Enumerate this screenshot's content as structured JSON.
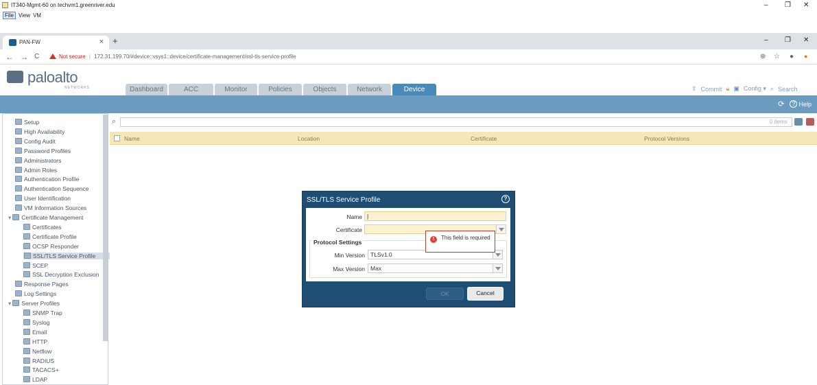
{
  "vm_window": {
    "title": "IT340-Mgmt-60 on techvm1.greenriver.edu",
    "menu": [
      "File",
      "View",
      "VM"
    ],
    "controls": [
      "–",
      "❐",
      "✕"
    ]
  },
  "browser": {
    "tab_title": "PAN-FW",
    "tab_close": "×",
    "new_tab": "+",
    "not_secure": "Not secure",
    "url": "172.31.199.70/#device::vsys1::device/certificate-management/ssl-tls-service-profile",
    "nav": [
      "←",
      "→",
      "C"
    ],
    "controls": [
      "–",
      "❐",
      "✕"
    ]
  },
  "app": {
    "logo_word": "paloalto",
    "logo_sub": "NETWORKS",
    "tabs": [
      "Dashboard",
      "ACC",
      "Monitor",
      "Policies",
      "Objects",
      "Network",
      "Device"
    ],
    "active_tab": "Device",
    "actions": {
      "commit": "Commit",
      "config": "Config ▾",
      "search": "Search"
    },
    "help": "Help"
  },
  "sidebar": {
    "items": [
      {
        "label": "Setup",
        "indent": 0
      },
      {
        "label": "High Availability",
        "indent": 0
      },
      {
        "label": "Config Audit",
        "indent": 0
      },
      {
        "label": "Password Profiles",
        "indent": 0
      },
      {
        "label": "Administrators",
        "indent": 0
      },
      {
        "label": "Admin Roles",
        "indent": 0
      },
      {
        "label": "Authentication Profile",
        "indent": 0
      },
      {
        "label": "Authentication Sequence",
        "indent": 0
      },
      {
        "label": "User Identification",
        "indent": 0
      },
      {
        "label": "VM Information Sources",
        "indent": 0
      },
      {
        "label": "Certificate Management",
        "indent": 0
      },
      {
        "label": "Certificates",
        "indent": 1
      },
      {
        "label": "Certificate Profile",
        "indent": 1
      },
      {
        "label": "OCSP Responder",
        "indent": 1
      },
      {
        "label": "SSL/TLS Service Profile",
        "indent": 1
      },
      {
        "label": "SCEP",
        "indent": 1
      },
      {
        "label": "SSL Decryption Exclusion",
        "indent": 1
      },
      {
        "label": "Response Pages",
        "indent": 0
      },
      {
        "label": "Log Settings",
        "indent": 0
      },
      {
        "label": "Server Profiles",
        "indent": 0
      },
      {
        "label": "SNMP Trap",
        "indent": 1
      },
      {
        "label": "Syslog",
        "indent": 1
      },
      {
        "label": "Email",
        "indent": 1
      },
      {
        "label": "HTTP",
        "indent": 1
      },
      {
        "label": "Netflow",
        "indent": 1
      },
      {
        "label": "RADIUS",
        "indent": 1
      },
      {
        "label": "TACACS+",
        "indent": 1
      },
      {
        "label": "LDAP",
        "indent": 1
      }
    ],
    "selected": "SSL/TLS Service Profile"
  },
  "table": {
    "items_count": "0 items",
    "columns": [
      "Name",
      "Location",
      "Certificate",
      "Protocol Versions"
    ]
  },
  "dialog": {
    "title": "SSL/TLS Service Profile",
    "name_label": "Name",
    "name_value": "|",
    "certificate_label": "Certificate",
    "certificate_value": "",
    "group_title": "Protocol Settings",
    "min_label": "Min Version",
    "min_value": "TLSv1.0",
    "max_label": "Max Version",
    "max_value": "Max",
    "tooltip": "This field is required",
    "ok": "OK",
    "cancel": "Cancel"
  },
  "colors": {
    "accent": "#4a8ab8",
    "dialog_bg": "#1f4d74",
    "header_row": "#f7e6b8",
    "error": "#d9453b"
  }
}
